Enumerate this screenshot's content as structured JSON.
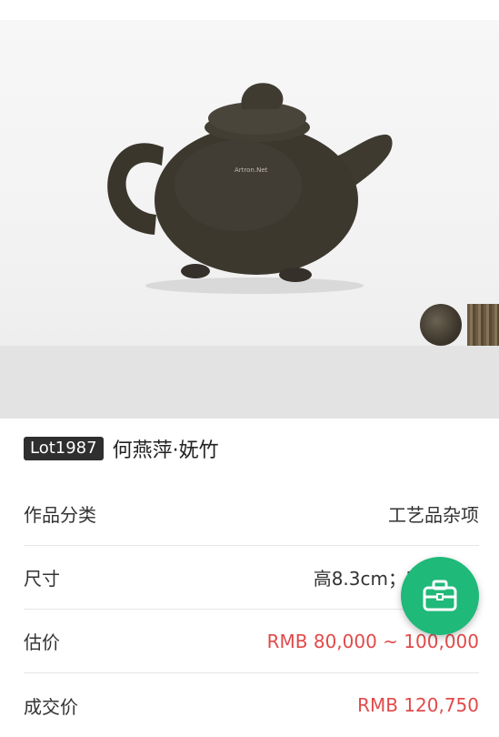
{
  "lot": {
    "badge": "Lot1987",
    "title": "何燕萍·妩竹"
  },
  "details": [
    {
      "label": "作品分类",
      "value": "工艺品杂项"
    },
    {
      "label": "尺寸",
      "value": "高8.3cm；宽"
    },
    {
      "label": "估价",
      "value": "RMB 80,000 ~ 100,000"
    },
    {
      "label": "成交价",
      "value": "RMB 120,750"
    }
  ],
  "photo": {
    "watermark": "Artron.Net"
  },
  "colors": {
    "accent_green": "#1fb97a",
    "price_red": "#e14a4a"
  },
  "fab": {
    "icon": "briefcase-icon"
  }
}
